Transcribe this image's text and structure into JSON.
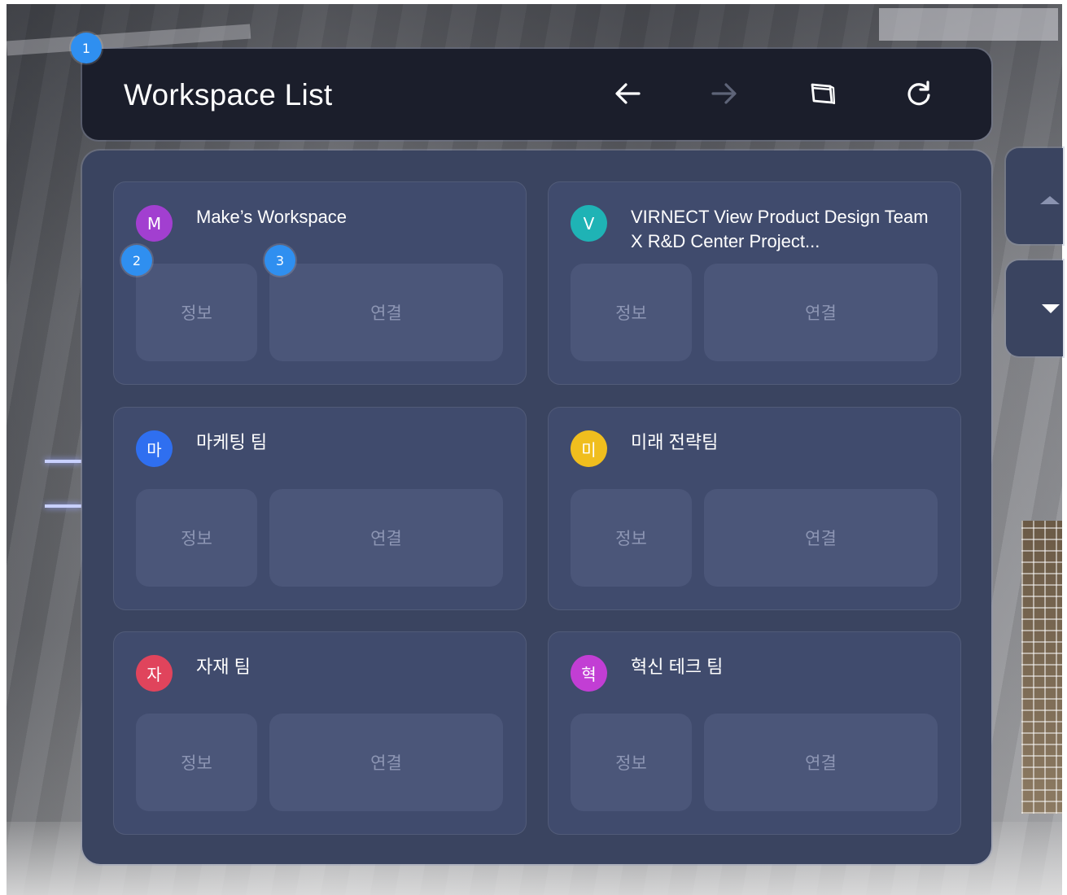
{
  "header": {
    "title": "Workspace List",
    "back_icon": "arrow-left-icon",
    "forward_icon": "arrow-right-icon",
    "window_icon": "window-switch-icon",
    "refresh_icon": "refresh-icon"
  },
  "markers": [
    "1",
    "2",
    "3"
  ],
  "workspaces": [
    {
      "initial": "M",
      "name": "Make’s Workspace",
      "color": "#a23fd0",
      "info_label": "정보",
      "connect_label": "연결"
    },
    {
      "initial": "V",
      "name": "VIRNECT View Product Design Team X R&D Center Project...",
      "color": "#1fb3b5",
      "info_label": "정보",
      "connect_label": "연결"
    },
    {
      "initial": "마",
      "name": "마케팅 팀",
      "color": "#2f6ff0",
      "info_label": "정보",
      "connect_label": "연결"
    },
    {
      "initial": "미",
      "name": "미래 전략팀",
      "color": "#f0be1e",
      "info_label": "정보",
      "connect_label": "연결"
    },
    {
      "initial": "자",
      "name": "자재 팀",
      "color": "#e0445c",
      "info_label": "정보",
      "connect_label": "연결"
    },
    {
      "initial": "혁",
      "name": "혁신 테크 팀",
      "color": "#c23ed4",
      "info_label": "정보",
      "connect_label": "연결"
    }
  ],
  "scroll": {
    "up_icon": "scroll-up-icon",
    "down_icon": "scroll-down-icon"
  }
}
